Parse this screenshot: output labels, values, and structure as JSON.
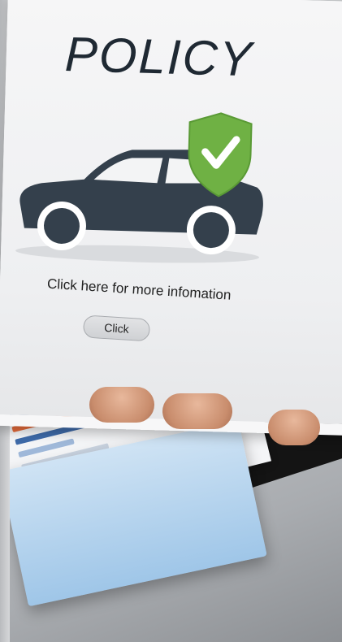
{
  "screen": {
    "title": "POLICY",
    "info_text": "Click here for more infomation",
    "button_label": "Click"
  },
  "icons": {
    "car": "car-icon",
    "shield": "shield-check-icon"
  },
  "colors": {
    "title_text": "#1f2933",
    "car_body": "#34404c",
    "shield_green": "#6fb144",
    "shield_check": "#ffffff"
  }
}
